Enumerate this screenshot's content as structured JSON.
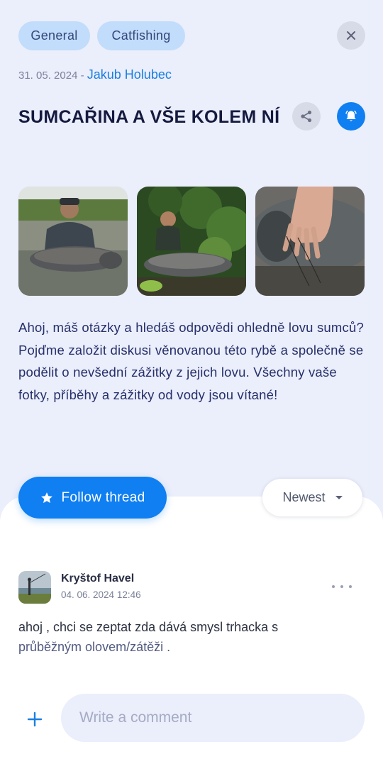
{
  "thread": {
    "tags": [
      "General",
      "Catfishing"
    ],
    "date": "31. 05. 2024",
    "separator": " - ",
    "author": "Jakub Holubec",
    "title": "SUMCAŘINA A VŠE KOLEM NÍ",
    "description": "Ahoj, máš otázky a hledáš odpovědi ohledně lovu sumců? Pojďme založit diskusi věnovanou této rybě a společně se podělit o nevšední zážitky z jejich lovu. Všechny vaše fotky, příběhy a zážitky od vody jsou vítané!"
  },
  "icons": {
    "close": "close-icon",
    "share": "share-icon",
    "notifications": "bell-icon",
    "follow": "star-icon",
    "sort": "chevron-down-icon",
    "more": "more-horizontal-icon",
    "add": "plus-icon"
  },
  "actions": {
    "follow_label": "Follow thread",
    "sort_selected": "Newest"
  },
  "comments": [
    {
      "author": "Kryštof Havel",
      "datetime": "04. 06. 2024 12:46",
      "text_main": "ahoj , chci se zeptat zda dává smysl trhacka s",
      "text_faded": "průběžným olovem/zátěži ."
    }
  ],
  "composer": {
    "placeholder": "Write a comment"
  },
  "colors": {
    "accent": "#0f7ff2",
    "background": "#ebeefb",
    "chip": "#c2dcfb",
    "title": "#151a3f"
  }
}
